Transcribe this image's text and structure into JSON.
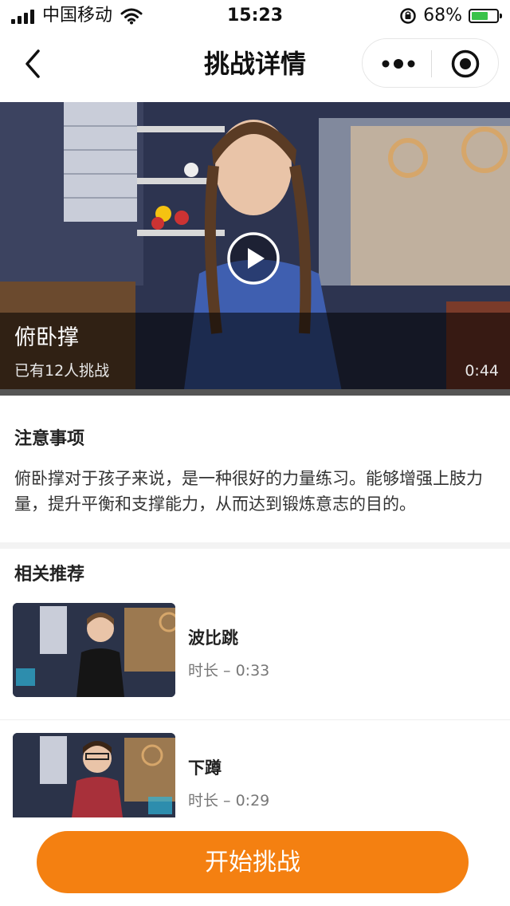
{
  "status_bar": {
    "carrier": "中国移动",
    "time": "15:23",
    "battery_percent": "68%",
    "battery_level": 0.68
  },
  "nav": {
    "title": "挑战详情"
  },
  "video": {
    "title": "俯卧撑",
    "participants": "已有12人挑战",
    "duration": "0:44"
  },
  "notes": {
    "heading": "注意事项",
    "text": "俯卧撑对于孩子来说，是一种很好的力量练习。能够增强上肢力量，提升平衡和支撑能力，从而达到锻炼意志的目的。"
  },
  "recommend": {
    "heading": "相关推荐",
    "items": [
      {
        "title": "波比跳",
        "duration": "时长 – 0:33"
      },
      {
        "title": "下蹲",
        "duration": "时长 – 0:29"
      }
    ]
  },
  "action": {
    "start_label": "开始挑战",
    "color": "#f48011"
  }
}
